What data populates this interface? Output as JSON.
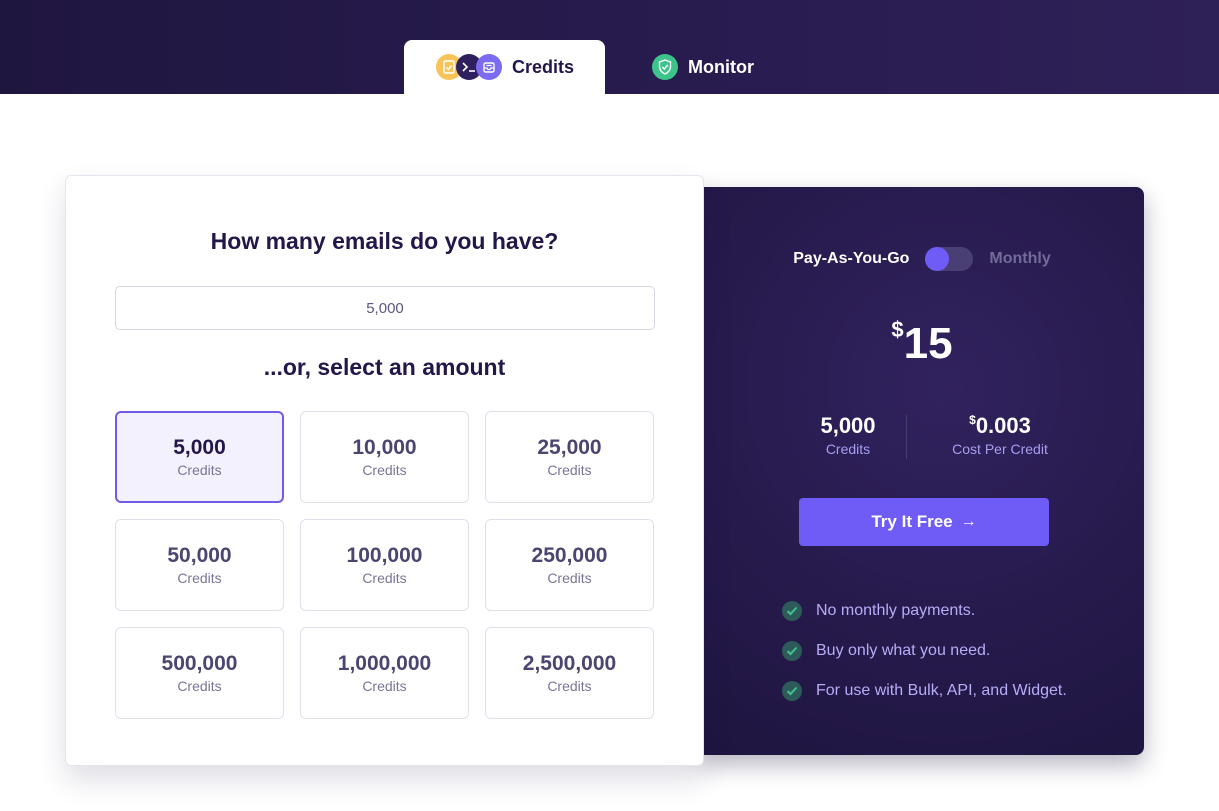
{
  "tabs": {
    "credits": {
      "label": "Credits",
      "icons": [
        "checklist-icon",
        "terminal-icon",
        "inbox-icon"
      ]
    },
    "monitor": {
      "label": "Monitor",
      "icon": "shield-check-icon"
    }
  },
  "calculator": {
    "question": "How many emails do you have?",
    "input_value": "5,000",
    "select_heading": "...or, select an amount",
    "selected_index": 0,
    "amounts": [
      {
        "value": "5,000",
        "label": "Credits"
      },
      {
        "value": "10,000",
        "label": "Credits"
      },
      {
        "value": "25,000",
        "label": "Credits"
      },
      {
        "value": "50,000",
        "label": "Credits"
      },
      {
        "value": "100,000",
        "label": "Credits"
      },
      {
        "value": "250,000",
        "label": "Credits"
      },
      {
        "value": "500,000",
        "label": "Credits"
      },
      {
        "value": "1,000,000",
        "label": "Credits"
      },
      {
        "value": "2,500,000",
        "label": "Credits"
      }
    ]
  },
  "pricing": {
    "toggle": {
      "left_label": "Pay-As-You-Go",
      "right_label": "Monthly",
      "active": "left"
    },
    "price": {
      "currency": "$",
      "amount": "15"
    },
    "credits": {
      "value": "5,000",
      "label": "Credits"
    },
    "cost_per_credit": {
      "currency": "$",
      "value": "0.003",
      "label": "Cost Per Credit"
    },
    "cta": {
      "label": "Try It Free",
      "arrow": "→"
    },
    "features": [
      "No monthly payments.",
      "Buy only what you need.",
      "For use with Bulk, API, and Widget."
    ]
  },
  "colors": {
    "accent": "#6f5cf6",
    "dark_panel": "#261a4c",
    "check": "#3cc48b"
  }
}
